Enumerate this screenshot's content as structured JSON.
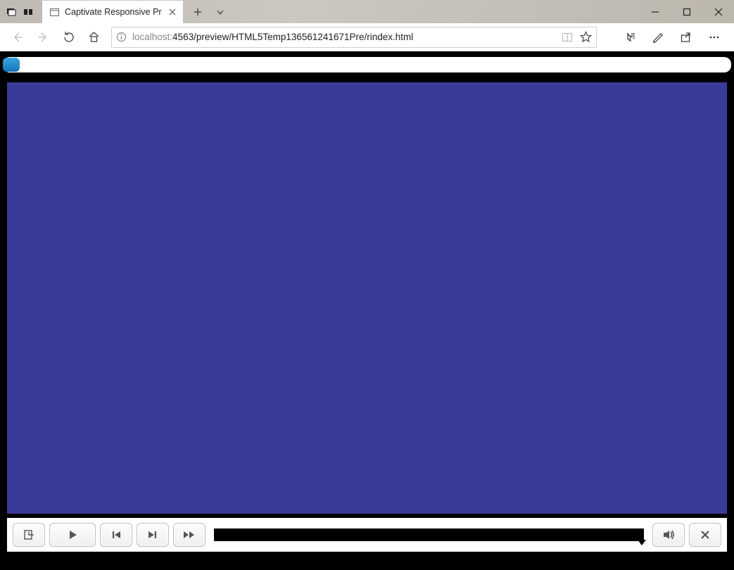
{
  "window": {
    "minimize": "Minimize",
    "maximize": "Maximize",
    "close": "Close"
  },
  "tab": {
    "title": "Captivate Responsive Pr"
  },
  "tabstrip": {
    "new_tab": "New tab",
    "tab_actions": "Tab actions"
  },
  "nav": {
    "back": "Back",
    "forward": "Forward",
    "refresh": "Refresh",
    "home": "Home",
    "info": "Site information"
  },
  "address": {
    "host": "localhost:",
    "path": "4563/preview/HTML5Temp136561241671Pre/rindex.html",
    "reading_view": "Reading view",
    "favorite": "Add to favorites"
  },
  "toolbar": {
    "favorites": "Favorites",
    "notes": "Notes",
    "share": "Share",
    "more": "Settings and more"
  },
  "player": {
    "toc": "Table of Contents",
    "play": "Play",
    "prev": "Previous",
    "next": "Next",
    "ff": "Fast Forward",
    "audio": "Audio",
    "exit": "Exit"
  }
}
